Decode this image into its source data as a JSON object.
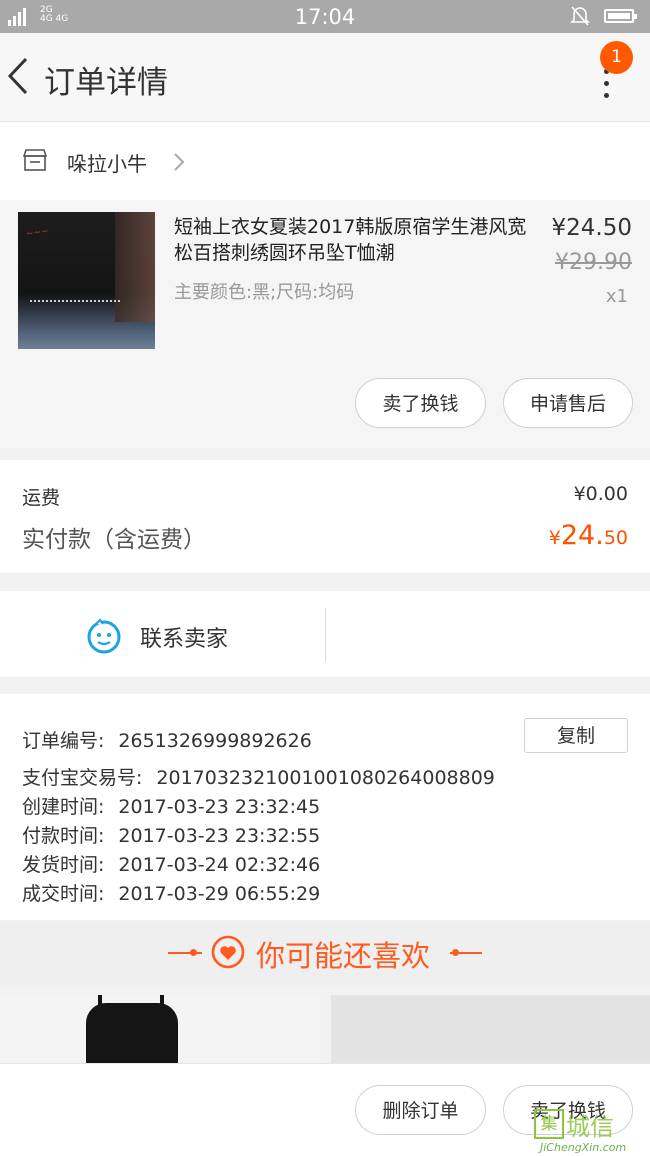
{
  "status_bar": {
    "network_left": "2G",
    "network_mid": "4G 4G",
    "time": "17:04",
    "icons": [
      "signal-icon",
      "bell-muted-icon",
      "battery-icon"
    ]
  },
  "header": {
    "title": "订单详情",
    "badge_count": "1",
    "icons": [
      "back-arrow-icon",
      "more-vertical-icon"
    ]
  },
  "shop": {
    "name": "哚拉小牛",
    "icon": "shop-icon"
  },
  "item": {
    "title": "短袖上衣女夏装2017韩版原宿学生港风宽松百搭刺绣圆环吊坠T恤潮",
    "sku": "主要颜色:黑;尺码:均码",
    "price": "¥24.50",
    "original_price": "¥29.90",
    "quantity": "x1",
    "sell_button": "卖了换钱",
    "aftersale_button": "申请售后"
  },
  "fees": {
    "shipping_label": "运费",
    "shipping_value": "¥0.00",
    "paid_label": "实付款（含运费）",
    "paid_yen": "¥",
    "paid_int": "24.",
    "paid_dec": "50"
  },
  "contact": {
    "label": "联系卖家",
    "icon": "chat-face-icon"
  },
  "order_info": {
    "copy_button": "复制",
    "rows": [
      {
        "label": "订单编号:",
        "value": "2651326999892626"
      },
      {
        "label": "支付宝交易号:",
        "value": "2017032321001001080264008809"
      },
      {
        "label": "创建时间:",
        "value": "2017-03-23 23:32:45"
      },
      {
        "label": "付款时间:",
        "value": "2017-03-23 23:32:55"
      },
      {
        "label": "发货时间:",
        "value": "2017-03-24 02:32:46"
      },
      {
        "label": "成交时间:",
        "value": "2017-03-29 06:55:29"
      }
    ]
  },
  "recommend": {
    "title": "你可能还喜欢",
    "icon": "heart-icon"
  },
  "bottom_bar": {
    "delete_button": "删除订单",
    "sell_button": "卖了换钱"
  },
  "watermark": {
    "cn": "城信",
    "en": "JiChengXin.com"
  },
  "colors": {
    "accent": "#ff5000",
    "badge": "#ff5a00",
    "status_bar": "#a9a9a9",
    "contact_icon": "#1aa3e8"
  }
}
